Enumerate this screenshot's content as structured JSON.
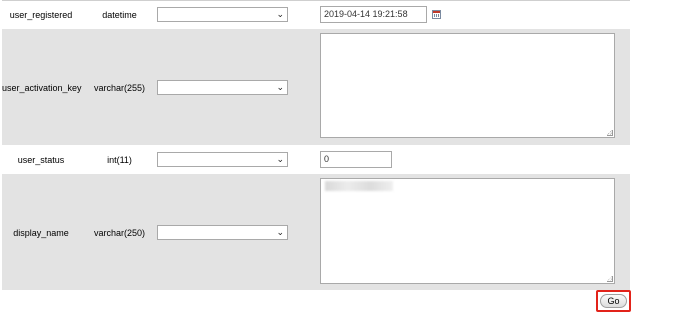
{
  "rows": [
    {
      "field": "user_registered",
      "type": "datetime",
      "function": "",
      "value": "2019-04-14 19:21:58"
    },
    {
      "field": "user_activation_key",
      "type": "varchar(255)",
      "function": "",
      "value": ""
    },
    {
      "field": "user_status",
      "type": "int(11)",
      "function": "",
      "value": "0"
    },
    {
      "field": "display_name",
      "type": "varchar(250)",
      "function": "",
      "value": ""
    }
  ],
  "icons": {
    "select_arrow": "chevron-down-icon",
    "calendar": "calendar-icon",
    "resize": "resize-handle-icon"
  },
  "go_button": {
    "label": "Go"
  },
  "colors": {
    "row_gray": "#e3e3e3",
    "highlight": "#e2231a",
    "border": "#a9a9a9"
  }
}
